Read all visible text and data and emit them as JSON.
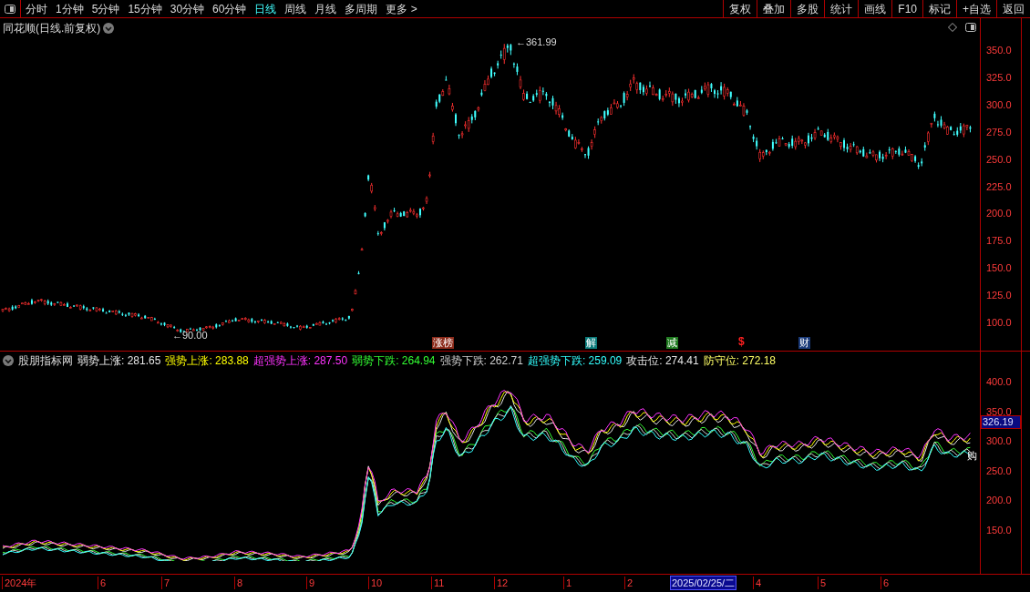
{
  "toolbar": {
    "periods": [
      {
        "label": "分时",
        "selected": false
      },
      {
        "label": "1分钟",
        "selected": false
      },
      {
        "label": "5分钟",
        "selected": false
      },
      {
        "label": "15分钟",
        "selected": false
      },
      {
        "label": "30分钟",
        "selected": false
      },
      {
        "label": "60分钟",
        "selected": false
      },
      {
        "label": "日线",
        "selected": true
      },
      {
        "label": "周线",
        "selected": false
      },
      {
        "label": "月线",
        "selected": false
      },
      {
        "label": "多周期",
        "selected": false
      },
      {
        "label": "更多 >",
        "selected": false
      }
    ],
    "actions": [
      "复权",
      "叠加",
      "多股",
      "统计",
      "画线",
      "F10",
      "标记",
      "+自选",
      "返回"
    ]
  },
  "price_panel": {
    "title": "同花顺(日线.前复权)",
    "high_label": "←361.99",
    "low_label": "←90.00",
    "y_ticks": [
      "350.0",
      "325.0",
      "300.0",
      "275.0",
      "250.0",
      "225.0",
      "200.0",
      "175.0",
      "150.0",
      "125.0",
      "100.0"
    ],
    "events": [
      {
        "kind": "tag",
        "text": "涨榜",
        "color": "#8b2a1a"
      },
      {
        "kind": "tag",
        "text": "解",
        "color": "#0a7a7a"
      },
      {
        "kind": "tag",
        "text": "减",
        "color": "#1f7a1f"
      },
      {
        "kind": "glyph",
        "text": "$",
        "color": "#ff2020"
      },
      {
        "kind": "tag",
        "text": "财",
        "color": "#1a3a78"
      }
    ]
  },
  "indicator_panel": {
    "title": "股朋指标网",
    "readouts": [
      {
        "text": "弱势上涨: 281.65",
        "color": "#e6e6e6"
      },
      {
        "text": "强势上涨: 283.88",
        "color": "#ffff00"
      },
      {
        "text": "超强势上涨: 287.50",
        "color": "#ff33ff"
      },
      {
        "text": "弱势下跌: 264.94",
        "color": "#33ff33"
      },
      {
        "text": "强势下跌: 262.71",
        "color": "#d0d0d0"
      },
      {
        "text": "超强势下跌: 259.09",
        "color": "#33ffff"
      },
      {
        "text": "攻击位: 274.41",
        "color": "#e6e6e6"
      },
      {
        "text": "防守位: 272.18",
        "color": "#ffff66"
      }
    ],
    "y_ticks": [
      "400.0",
      "350.0",
      "300.0",
      "250.0",
      "200.0",
      "150.0"
    ],
    "current_value": "326.19",
    "signal": "购"
  },
  "date_axis": {
    "labels": [
      {
        "text": "2024年",
        "selected": false
      },
      {
        "text": "6",
        "selected": false
      },
      {
        "text": "7",
        "selected": false
      },
      {
        "text": "8",
        "selected": false
      },
      {
        "text": "9",
        "selected": false
      },
      {
        "text": "10",
        "selected": false
      },
      {
        "text": "11",
        "selected": false
      },
      {
        "text": "12",
        "selected": false
      },
      {
        "text": "1",
        "selected": false
      },
      {
        "text": "2",
        "selected": false
      },
      {
        "text": "2025/02/25/二",
        "selected": true
      },
      {
        "text": "4",
        "selected": false
      },
      {
        "text": "5",
        "selected": false
      },
      {
        "text": "6",
        "selected": false
      }
    ]
  }
}
